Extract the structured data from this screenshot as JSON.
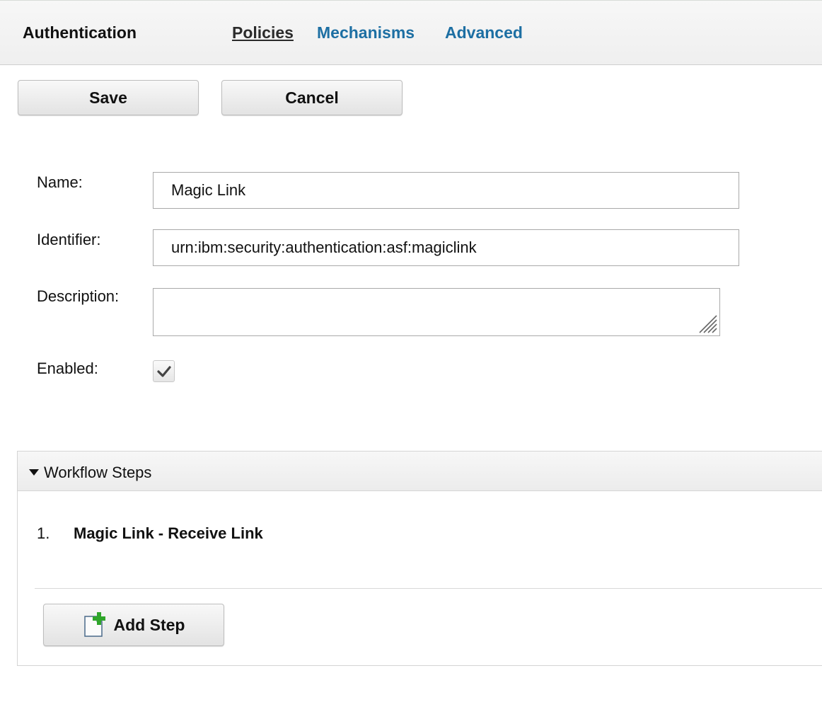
{
  "header": {
    "title": "Authentication",
    "tabs": [
      {
        "label": "Policies",
        "active": true
      },
      {
        "label": "Mechanisms",
        "active": false
      },
      {
        "label": "Advanced",
        "active": false
      }
    ]
  },
  "toolbar": {
    "save_label": "Save",
    "cancel_label": "Cancel"
  },
  "form": {
    "name_label": "Name:",
    "name_value": "Magic Link",
    "identifier_label": "Identifier:",
    "identifier_value": "urn:ibm:security:authentication:asf:magiclink",
    "description_label": "Description:",
    "description_value": "",
    "enabled_label": "Enabled:",
    "enabled": true
  },
  "workflow": {
    "section_title": "Workflow Steps",
    "expanded": true,
    "steps": [
      {
        "number": "1.",
        "name": "Magic Link - Receive Link"
      }
    ],
    "add_step_label": "Add Step",
    "add_step_icon": "add-document-icon"
  },
  "colors": {
    "link": "#1d6fa3",
    "add_icon_green": "#2fa52a"
  }
}
